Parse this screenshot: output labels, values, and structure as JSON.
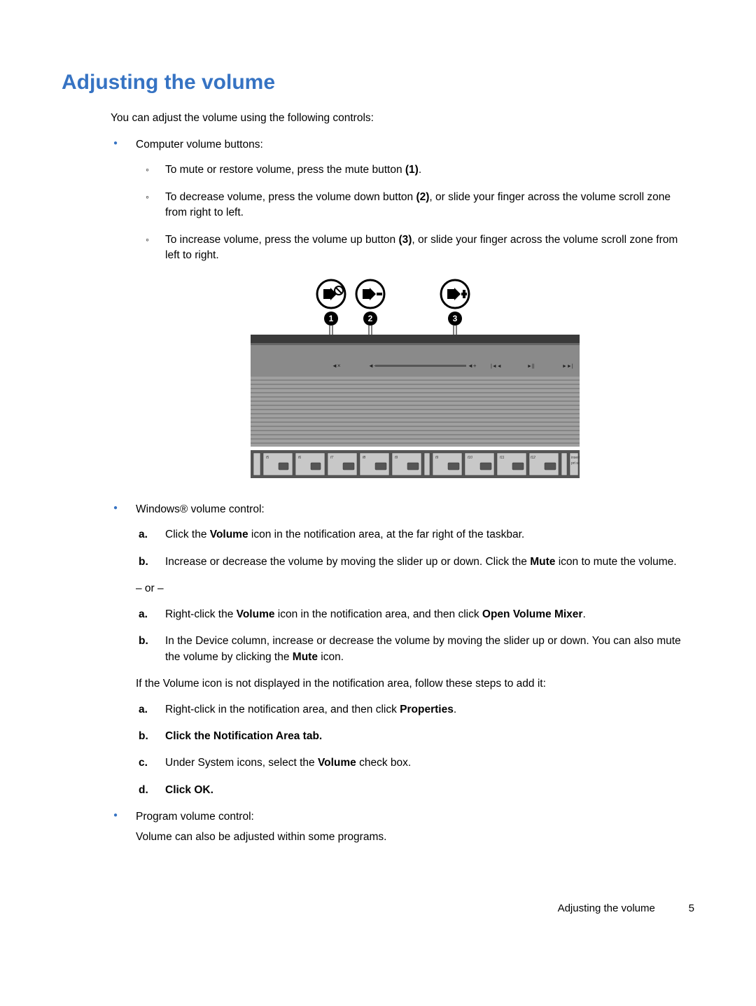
{
  "title": "Adjusting the volume",
  "intro": "You can adjust the volume using the following controls:",
  "bullet1_lead": "Computer volume buttons:",
  "sub1": "To mute or restore volume, press the mute button ",
  "sub1_bold": "(1)",
  "sub1_tail": ".",
  "sub2a": "To decrease volume, press the volume down button ",
  "sub2_bold": "(2)",
  "sub2b": ", or slide your finger across the volume scroll zone from right to left.",
  "sub3a": "To increase volume, press the volume up button ",
  "sub3_bold": "(3)",
  "sub3b": ", or slide your finger across the volume scroll zone from left to right.",
  "bullet2_lead": "Windows® volume control:",
  "b2_a1a": "Click the ",
  "b2_a1_bold": "Volume",
  "b2_a1b": " icon in the notification area, at the far right of the taskbar.",
  "b2_b1a": "Increase or decrease the volume by moving the slider up or down. Click the ",
  "b2_b1_bold": "Mute",
  "b2_b1b": " icon to mute the volume.",
  "or_text": "– or –",
  "b2_a2a": "Right-click the ",
  "b2_a2_bold1": "Volume",
  "b2_a2b": " icon in the notification area, and then click ",
  "b2_a2_bold2": "Open Volume Mixer",
  "b2_a2c": ".",
  "b2_b2a": "In the Device column, increase or decrease the volume by moving the slider up or down. You can also mute the volume by clicking the ",
  "b2_b2_bold": "Mute",
  "b2_b2b": " icon.",
  "b2_note": "If the Volume icon is not displayed in the notification area, follow these steps to add it:",
  "b2_s_a_a": "Right-click in the notification area, and then click ",
  "b2_s_a_bold": "Properties",
  "b2_s_a_b": ".",
  "b2_s_b_a": "Click the ",
  "b2_s_b_bold": "Notification Area",
  "b2_s_b_b": " tab.",
  "b2_s_c_a": "Under System icons, select the ",
  "b2_s_c_bold": "Volume",
  "b2_s_c_b": " check box.",
  "b2_s_d_a": "Click ",
  "b2_s_d_bold": "OK",
  "b2_s_d_b": ".",
  "bullet3_lead": "Program volume control:",
  "bullet3_para": "Volume can also be adjusted within some programs.",
  "footer_text": "Adjusting the volume",
  "page_number": "5",
  "markers": {
    "a": "a.",
    "b": "b.",
    "c": "c.",
    "d": "d."
  }
}
